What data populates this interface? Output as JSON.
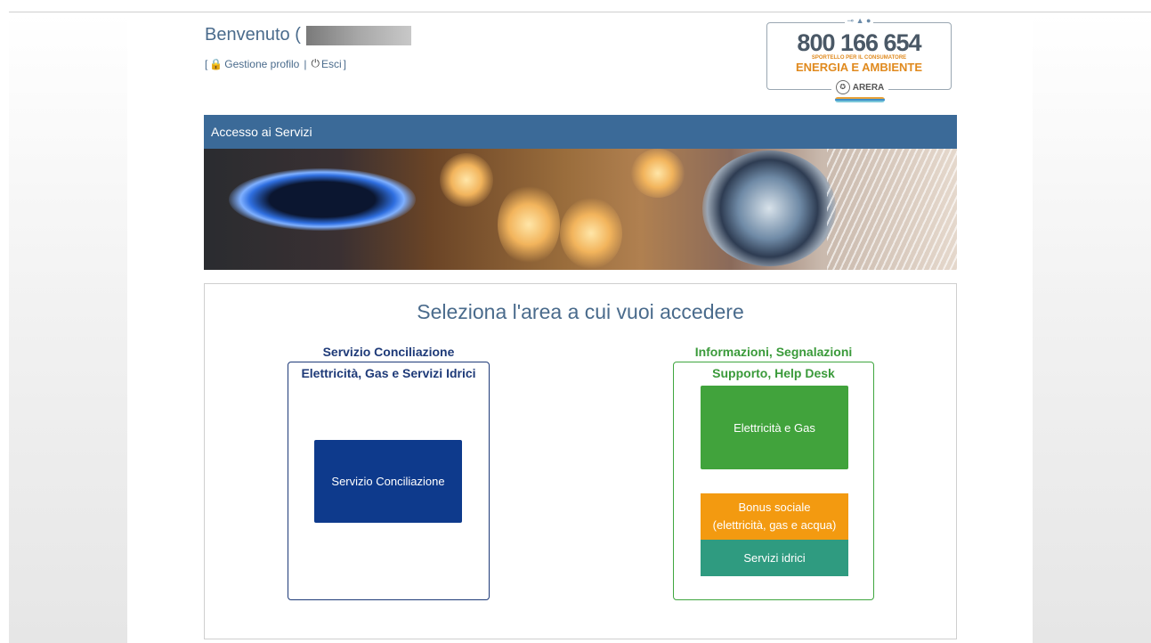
{
  "header": {
    "welcome": "Benvenuto",
    "welcome_initial": "(",
    "link_open": "[",
    "profile_label": "Gestione profilo",
    "separator": "|",
    "logout_label": "Esci",
    "link_close": "]"
  },
  "badge": {
    "phone": "800 166 654",
    "subtitle": "SPORTELLO PER IL CONSUMATORE",
    "title": "ENERGIA E AMBIENTE",
    "org": "ARERA",
    "top_icons": "⊸ ▲ ●"
  },
  "section_bar": {
    "title": "Accesso ai Servizi"
  },
  "panel": {
    "title": "Seleziona l'area a cui vuoi accedere",
    "left_group": {
      "legend_line1": "Servizio Conciliazione",
      "legend_line2": "Elettricità, Gas e Servizi Idrici",
      "button": "Servizio Conciliazione",
      "color": "#0e3a8c"
    },
    "right_group": {
      "legend_line1": "Informazioni, Segnalazioni",
      "legend_line2": "Supporto, Help Desk",
      "btn_energy": "Elettricità e Gas",
      "btn_bonus_line1": "Bonus sociale",
      "btn_bonus_line2": "(elettricità, gas e acqua)",
      "btn_water": "Servizi idrici",
      "colors": {
        "energy": "#41a33c",
        "bonus": "#f39a10",
        "water": "#2f9b80"
      }
    }
  }
}
